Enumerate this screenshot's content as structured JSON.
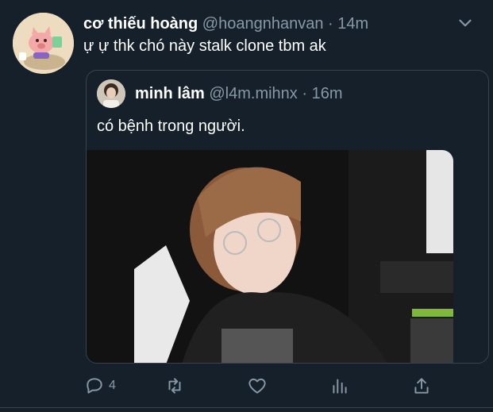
{
  "tweet": {
    "display_name": "cơ thiếu hoàng",
    "handle": "@hoangnhanvan",
    "separator": "·",
    "time": "14m",
    "text": "ự ự thk chó này stalk clone tbm ak"
  },
  "quote": {
    "display_name": "minh lâm",
    "handle": "@l4m.mihnx",
    "separator": "·",
    "time": "16m",
    "text": "có bệnh trong người."
  },
  "actions": {
    "reply_count": "4"
  },
  "icons": {
    "more": "chevron-down-icon",
    "reply": "reply-icon",
    "retweet": "retweet-icon",
    "like": "heart-icon",
    "analytics": "analytics-icon",
    "share": "share-icon"
  },
  "colors": {
    "background": "#15202b",
    "secondary_text": "#8899a6",
    "border": "#38444d"
  }
}
